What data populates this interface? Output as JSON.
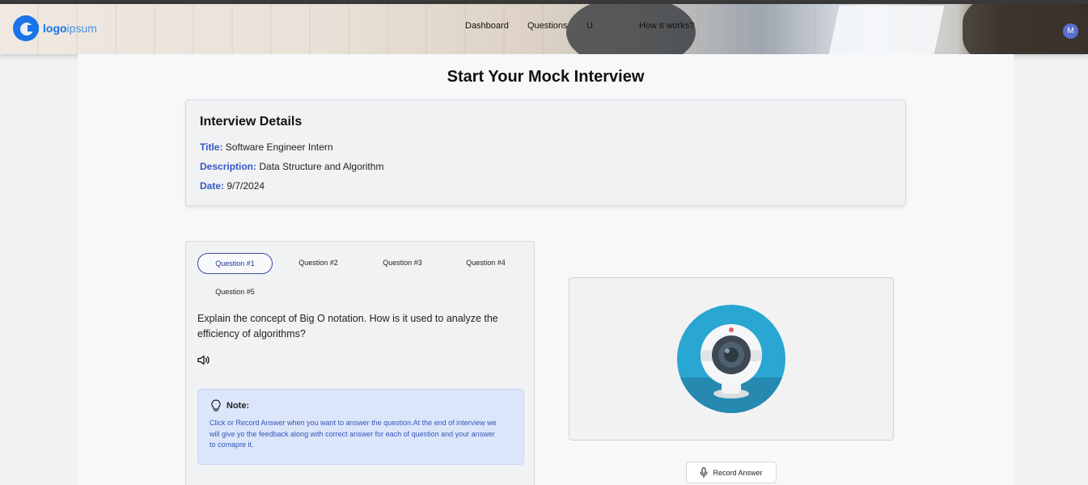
{
  "header": {
    "logo": {
      "bold": "logo",
      "light": "ipsum"
    },
    "nav": [
      "Dashboard",
      "Questions",
      "U",
      "How it works?"
    ],
    "avatar_initial": "M"
  },
  "page_title": "Start Your Mock Interview",
  "details": {
    "heading": "Interview Details",
    "title_label": "Title:",
    "title_value": "Software Engineer Intern",
    "description_label": "Description:",
    "description_value": "Data Structure and Algorithm",
    "date_label": "Date:",
    "date_value": "9/7/2024"
  },
  "questions": {
    "tabs": [
      "Question #1",
      "Question #2",
      "Question #3",
      "Question #4",
      "Question #5"
    ],
    "active_index": 0,
    "current_text": "Explain the concept of Big O notation. How is it used to analyze the efficiency of algorithms?",
    "speaker_icon": "speaker-icon"
  },
  "note": {
    "icon": "lightbulb-icon",
    "title": "Note:",
    "body": "Click or Record Answer when you want to answer the question.At the end of interview we will give yo the feedback along with correct answer for each of question and your answer to comapre it."
  },
  "webcam": {
    "icon": "webcam-icon"
  },
  "record_button": {
    "label": "Record Answer",
    "icon": "microphone-icon"
  },
  "colors": {
    "accent": "#3657c6",
    "note_bg": "#dbe6fb",
    "cam_blue": "#2aa6d2"
  }
}
